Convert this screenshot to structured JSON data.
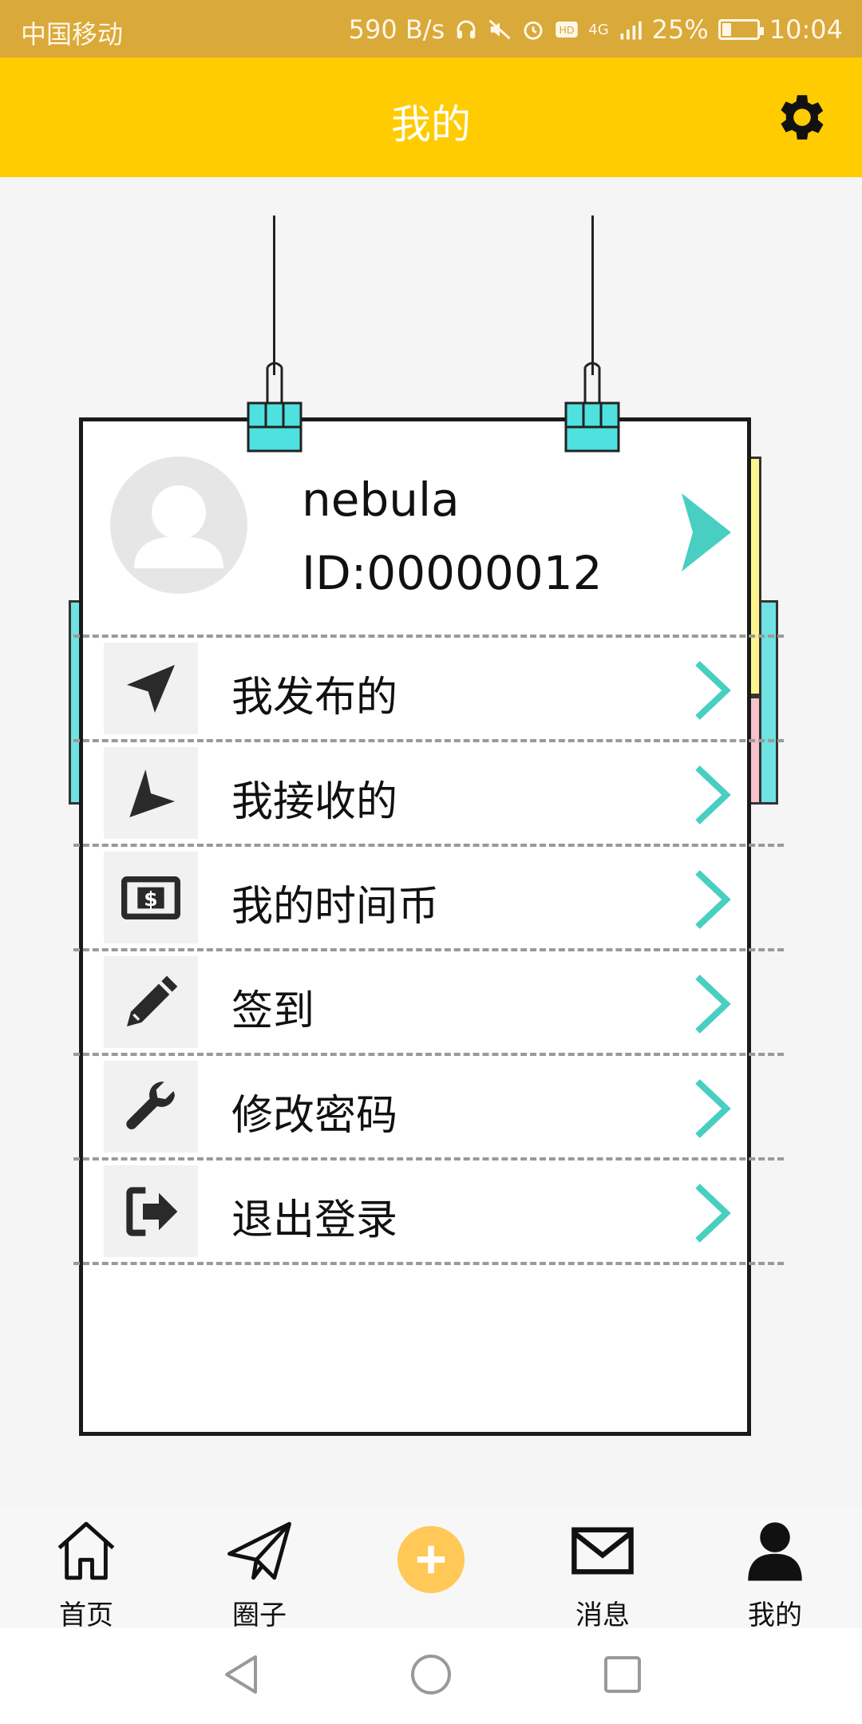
{
  "status_bar": {
    "carrier": "中国移动",
    "net_speed": "590 B/s",
    "network": "4G",
    "battery": "25%",
    "time": "10:04"
  },
  "header": {
    "title": "我的",
    "settings_icon": "gear-icon"
  },
  "profile": {
    "username": "nebula",
    "user_id": "ID:00000012"
  },
  "menu": {
    "items": [
      {
        "label": "我发布的",
        "icon": "navigation-arrow-icon"
      },
      {
        "label": "我接收的",
        "icon": "location-arrow-icon"
      },
      {
        "label": "我的时间币",
        "icon": "money-icon"
      },
      {
        "label": "签到",
        "icon": "pencil-icon"
      },
      {
        "label": "修改密码",
        "icon": "wrench-icon"
      },
      {
        "label": "退出登录",
        "icon": "sign-out-icon"
      }
    ]
  },
  "bottom_nav": {
    "items": [
      {
        "label": "首页",
        "icon": "home-icon"
      },
      {
        "label": "圈子",
        "icon": "paper-plane-icon"
      },
      {
        "label": "",
        "icon": "plus-icon"
      },
      {
        "label": "消息",
        "icon": "envelope-icon"
      },
      {
        "label": "我的",
        "icon": "user-icon"
      }
    ]
  },
  "colors": {
    "header": "#fecc00",
    "status_bar": "#d9a93a",
    "accent_chevron": "#48cfc1",
    "add_button": "#ffc857"
  }
}
